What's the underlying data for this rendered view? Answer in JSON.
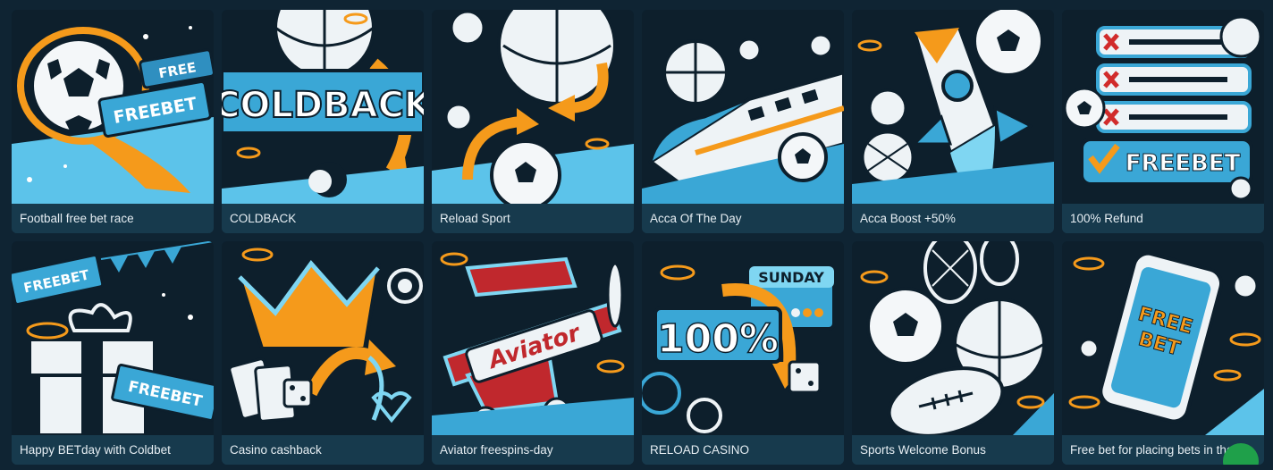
{
  "promotions": [
    {
      "title": "Football free bet race",
      "art": "football-freebet",
      "banner": "FREEBET"
    },
    {
      "title": "COLDBACK",
      "art": "coldback",
      "banner": "COLDBACK"
    },
    {
      "title": "Reload Sport",
      "art": "reload-sport",
      "banner": ""
    },
    {
      "title": "Acca Of The Day",
      "art": "acca-train",
      "banner": ""
    },
    {
      "title": "Acca Boost +50%",
      "art": "acca-rocket",
      "banner": ""
    },
    {
      "title": "100% Refund",
      "art": "refund",
      "banner": "FREEBET"
    },
    {
      "title": "Happy BETday with Coldbet",
      "art": "betday-gift",
      "banner": "FREEBET"
    },
    {
      "title": "Casino cashback",
      "art": "casino-crown",
      "banner": ""
    },
    {
      "title": "Aviator freespins-day",
      "art": "aviator-plane",
      "banner": "Aviator"
    },
    {
      "title": "RELOAD CASINO",
      "art": "reload-casino",
      "banner": "100%",
      "sub_banner": "SUNDAY"
    },
    {
      "title": "Sports Welcome Bonus",
      "art": "sports-balls",
      "banner": ""
    },
    {
      "title": "Free bet for placing bets in the…",
      "art": "phone-freebet",
      "banner": "FREE BET"
    }
  ],
  "colors": {
    "background": "#0f2433",
    "caption_bg": "#173a4d",
    "art_bg": "#0d1f2c",
    "accent_orange": "#f59a1b",
    "accent_ice": "#7fd6f2",
    "badge_green": "#1fa04a"
  }
}
